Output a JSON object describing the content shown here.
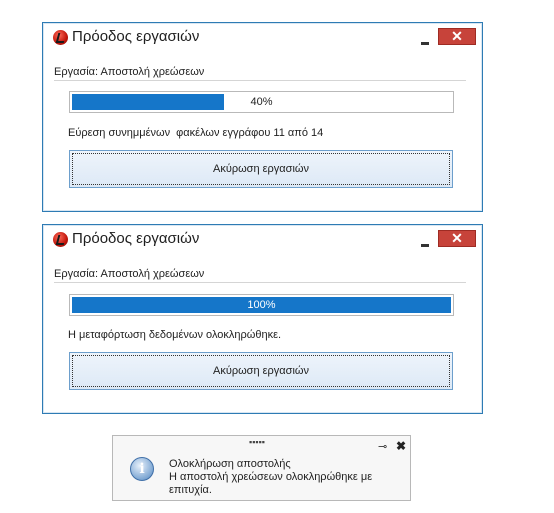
{
  "dialog1": {
    "title": "Πρόοδος εργασιών",
    "close_label": "✕",
    "task_label": "Εργασία: Αποστολή χρεώσεων",
    "progress_percent": 40,
    "progress_text": "40%",
    "status": "Εύρεση συνημμένων  φακέλων εγγράφου 11 από 14",
    "cancel_label": "Ακύρωση εργασιών"
  },
  "dialog2": {
    "title": "Πρόοδος εργασιών",
    "close_label": "✕",
    "task_label": "Εργασία: Αποστολή χρεώσεων",
    "progress_percent": 100,
    "progress_text": "100%",
    "status": "Η μεταφόρτωση δεδομένων ολοκληρώθηκε.",
    "cancel_label": "Ακύρωση εργασιών"
  },
  "notification": {
    "grip": "▪▪▪▪▪",
    "pin_glyph": "⊸",
    "close_glyph": "✖",
    "info_glyph": "i",
    "title": "Ολοκλήρωση αποστολής",
    "message": "Η αποστολή χρεώσεων ολοκληρώθηκε με επιτυχία."
  },
  "colors": {
    "window_border": "#2e7bb4",
    "progress_fill": "#1576c9",
    "close_button": "#c7433a"
  },
  "icons": {
    "app": "app-logo-icon",
    "minimize": "minimize-icon",
    "close": "close-icon",
    "info": "info-icon",
    "pin": "pin-icon"
  }
}
